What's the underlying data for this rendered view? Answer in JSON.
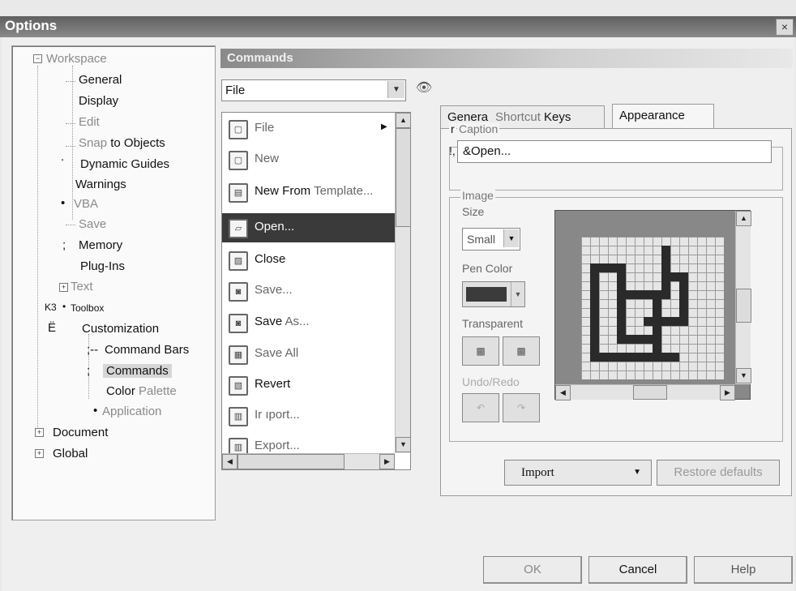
{
  "window": {
    "title": "Options",
    "close_glyph": "×"
  },
  "tree": {
    "workspace": "Workspace",
    "general": "General",
    "display": "Display",
    "edit": "Edit",
    "snap_a": "Snap",
    "snap_b": "to Objects",
    "dynamic_guides": "Dynamic Guides",
    "warnings": "Warnings",
    "vba": "VBA",
    "save": "Save",
    "memory": "Memory",
    "plugins": "Plug-Ins",
    "text": "Text",
    "toolbox": "Toolbox",
    "customization": "Customization",
    "command_bars": "Command Bars",
    "commands": "Commands",
    "color_a": "Color",
    "color_b": "Palette",
    "application": "Application",
    "document": "Document",
    "global": "Global",
    "marks": {
      "dot": ".",
      "bullet": "•",
      "semicolon": ";",
      "k3": "K3",
      "e_umlaut": "Ë",
      "cmdbars_prefix": ";--"
    }
  },
  "header": {
    "title": "Commands"
  },
  "command_category": {
    "value": "File"
  },
  "commands_list": [
    {
      "label": "File",
      "icon": "file-icon",
      "glyph": "▢"
    },
    {
      "label": "New",
      "icon": "new-document-icon",
      "glyph": "▢"
    },
    {
      "label_a": "New From",
      "label_b": "Template...",
      "icon": "template-icon",
      "glyph": "▤"
    },
    {
      "label": "Open...",
      "icon": "open-folder-icon",
      "glyph": "▱",
      "selected": true
    },
    {
      "label": "Close",
      "icon": "close-document-icon",
      "glyph": "▨"
    },
    {
      "label": "Save...",
      "icon": "save-icon",
      "glyph": "◙"
    },
    {
      "label_a": "Save",
      "label_b": "As...",
      "icon": "save-as-icon",
      "glyph": "◙"
    },
    {
      "label": "Save All",
      "icon": "save-all-icon",
      "glyph": "▦"
    },
    {
      "label": "Revert",
      "icon": "revert-icon",
      "glyph": "▧"
    },
    {
      "label": "Ir ıport...",
      "icon": "import-icon",
      "glyph": "▥"
    },
    {
      "label": "Export...",
      "icon": "export-icon",
      "glyph": "▥"
    }
  ],
  "tabs": {
    "general": "General j",
    "shortcut_a": "Shortcut",
    "shortcut_b": "Keys",
    "appearance": "Appearance"
  },
  "caption": {
    "label": "Caption",
    "label_prefix": "r",
    "value": "&Open...",
    "prefix": "!,"
  },
  "image": {
    "label": "Image",
    "size_label": "Size",
    "size_value": "Small",
    "pen_color_label": "Pen Color",
    "pen_color": "#3b3b3b",
    "transparent_label": "Transparent",
    "undo_redo_label": "Undo/Redo"
  },
  "buttons": {
    "import": "Import",
    "restore_defaults": "Restore defaults",
    "ok": "OK",
    "cancel": "Cancel",
    "help": "Help"
  },
  "glyphs": {
    "down": "▼",
    "up": "▲",
    "left": "◀",
    "right": "▶",
    "minus": "−",
    "plus": "+",
    "submenu": "▶",
    "binoculars": "👁"
  }
}
